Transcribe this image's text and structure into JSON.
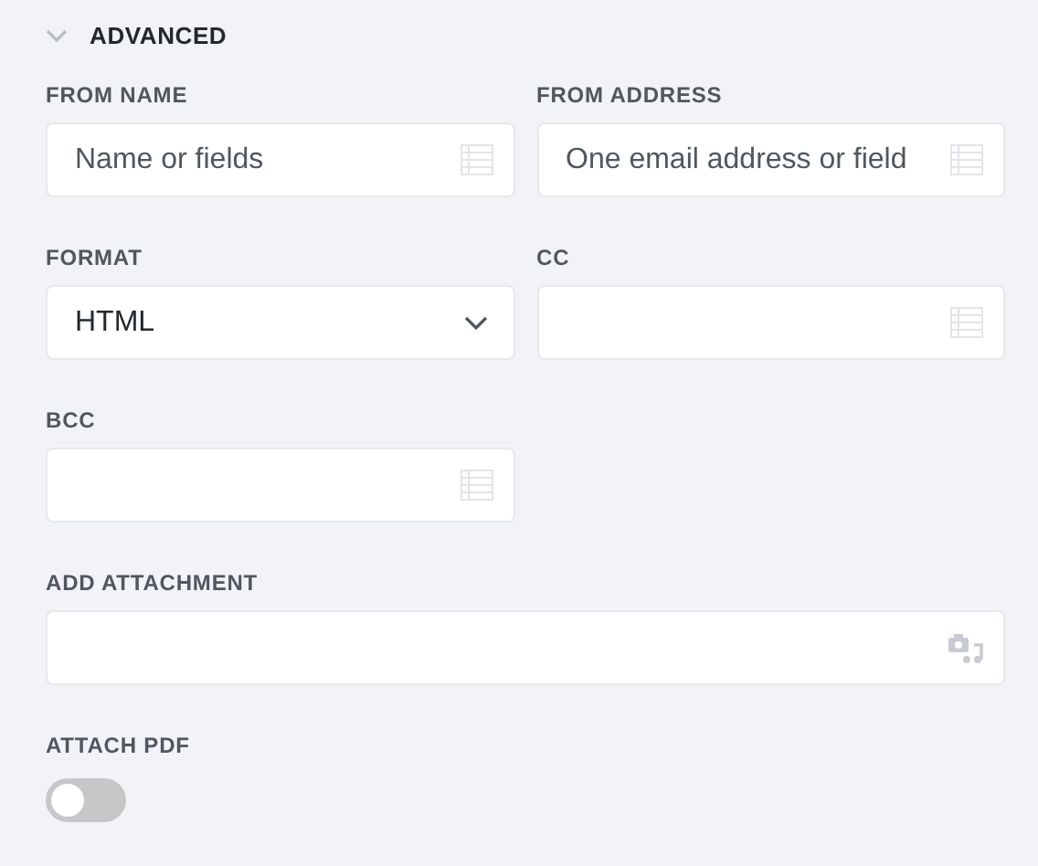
{
  "section": {
    "title": "ADVANCED",
    "expanded": true
  },
  "fields": [
    {
      "kind": "text",
      "label": "FROM NAME",
      "placeholder": "Name or fields"
    },
    {
      "kind": "text",
      "label": "FROM ADDRESS",
      "placeholder": "One email address or field"
    },
    {
      "kind": "select",
      "label": "FORMAT",
      "value": "HTML"
    },
    {
      "kind": "text",
      "label": "CC"
    },
    {
      "kind": "text",
      "label": "BCC"
    },
    {
      "kind": "media",
      "label": "ADD ATTACHMENT"
    },
    {
      "kind": "toggle",
      "label": "ATTACH PDF",
      "on": false
    }
  ]
}
